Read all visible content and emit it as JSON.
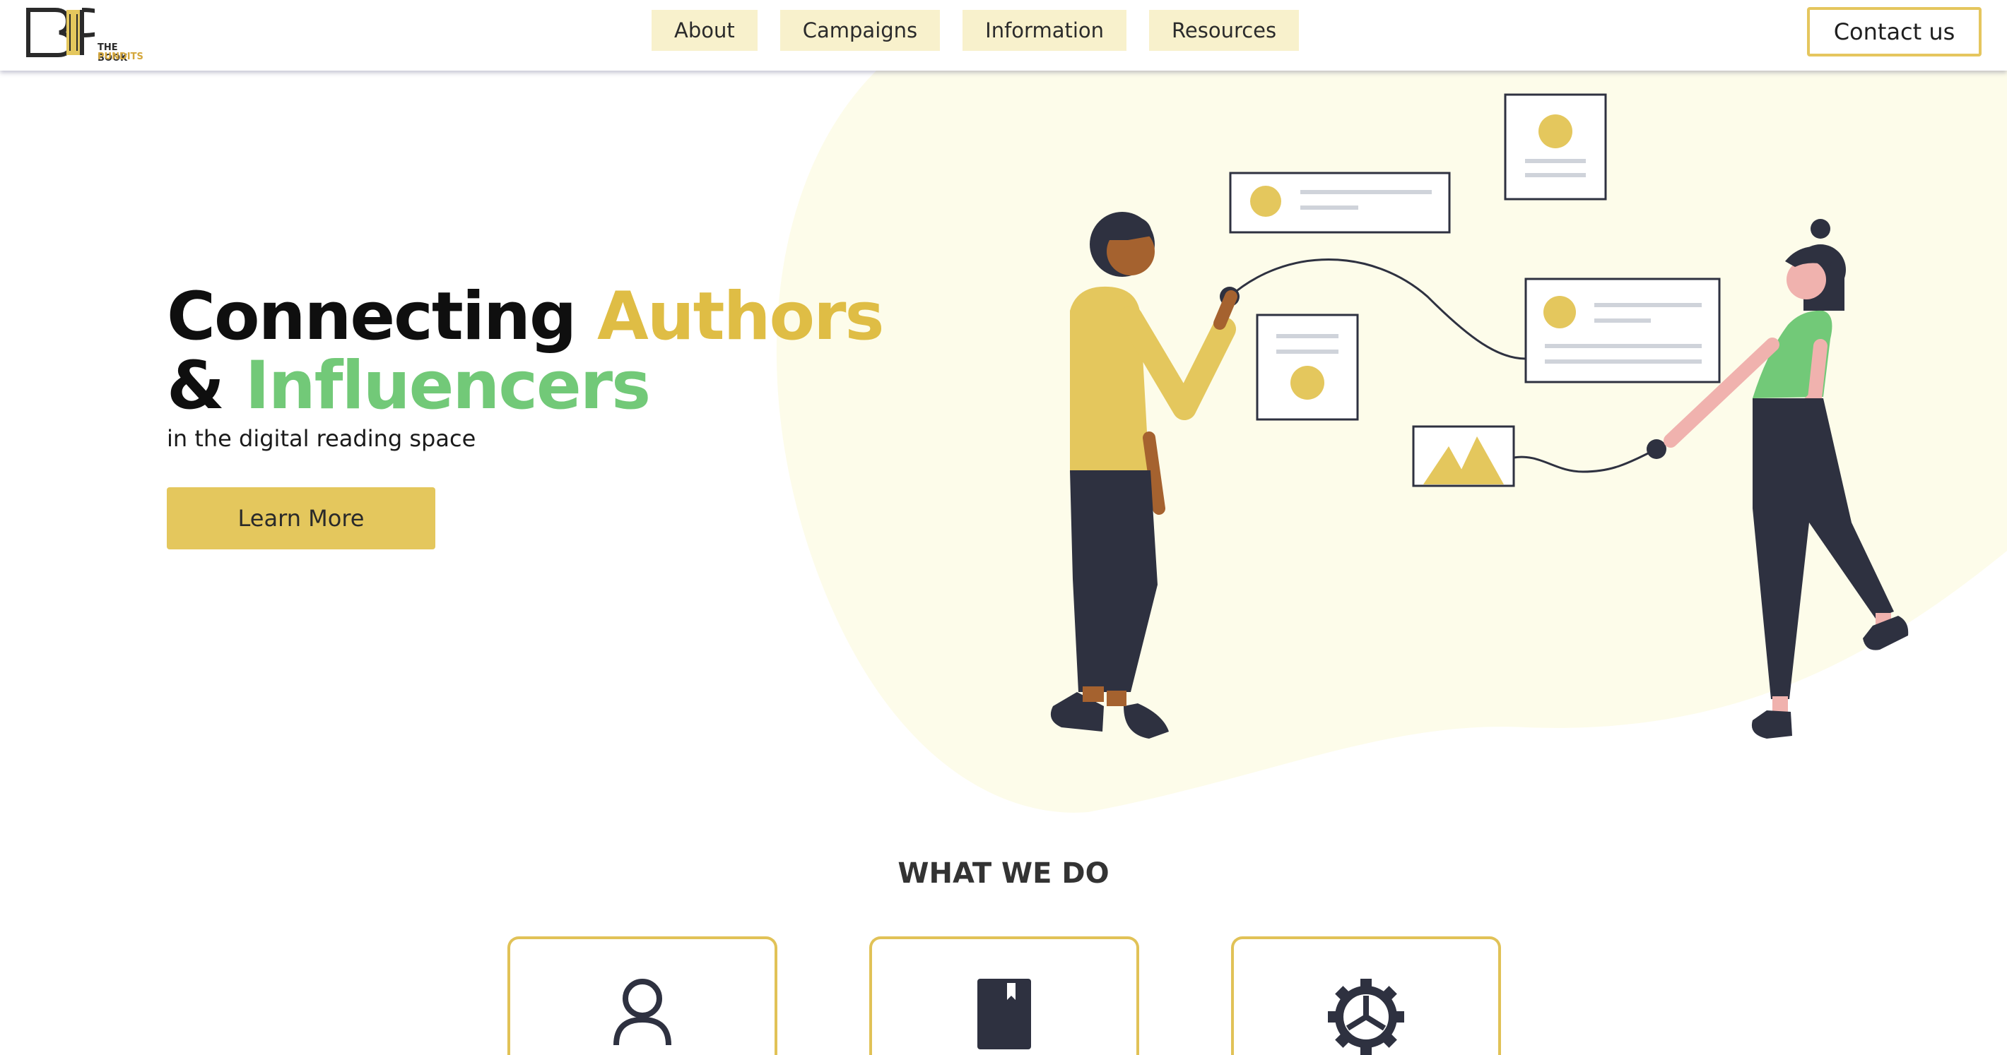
{
  "brand": {
    "logo_line1": "THE BOOK",
    "logo_line2": "PUNDITS",
    "logo_letters": "BP"
  },
  "nav": {
    "items": [
      {
        "label": "About"
      },
      {
        "label": "Campaigns"
      },
      {
        "label": "Information"
      },
      {
        "label": "Resources"
      }
    ],
    "contact_label": "Contact us"
  },
  "hero": {
    "headline_word1": "Connecting",
    "headline_word2": "Authors",
    "headline_amp": "&",
    "headline_word3": "Influencers",
    "subline": "in the digital reading space",
    "cta_label": "Learn More"
  },
  "section": {
    "title": "WHAT WE DO",
    "cards": [
      {
        "icon": "user-icon"
      },
      {
        "icon": "book-icon"
      },
      {
        "icon": "gear-icon"
      }
    ]
  },
  "colors": {
    "accent_yellow": "#e4c75d",
    "accent_green": "#72c978",
    "nav_bg": "#f8f1cc",
    "blob_bg": "#fdfcec",
    "dark": "#2e3140"
  }
}
